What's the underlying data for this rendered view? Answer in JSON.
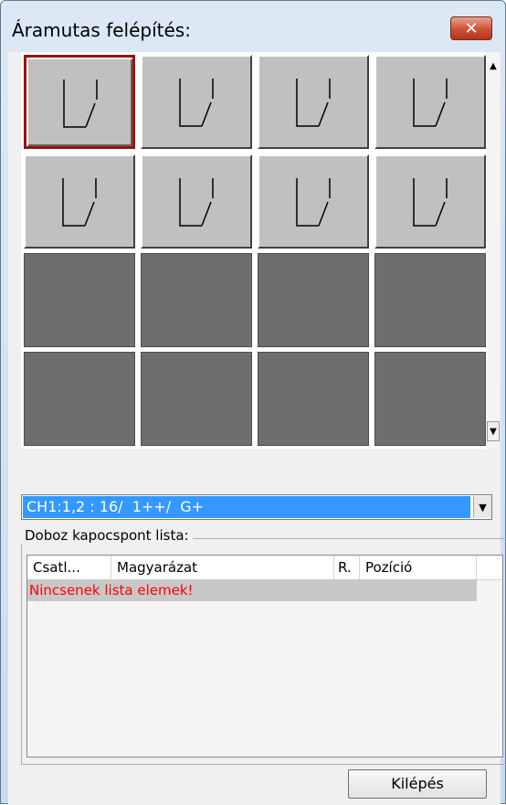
{
  "window": {
    "title": "Áramutas felépítés:",
    "close_label": "✕"
  },
  "tiles": [
    {
      "state": "selected",
      "symbol": "switch-icon"
    },
    {
      "state": "normal",
      "symbol": "switch-icon"
    },
    {
      "state": "normal",
      "symbol": "switch-icon"
    },
    {
      "state": "normal",
      "symbol": "switch-icon"
    },
    {
      "state": "normal",
      "symbol": "switch-icon"
    },
    {
      "state": "normal",
      "symbol": "switch-icon"
    },
    {
      "state": "normal",
      "symbol": "switch-icon"
    },
    {
      "state": "normal",
      "symbol": "switch-icon"
    },
    {
      "state": "empty"
    },
    {
      "state": "empty"
    },
    {
      "state": "empty"
    },
    {
      "state": "empty"
    },
    {
      "state": "empty"
    },
    {
      "state": "empty"
    },
    {
      "state": "empty"
    },
    {
      "state": "empty"
    }
  ],
  "scrollbar": {
    "up_icon": "▲",
    "down_icon": "▼"
  },
  "combo": {
    "value": "CH1:1,2 : 16/  1++/  G+",
    "arrow_icon": "▼"
  },
  "group": {
    "label": "Doboz kapocspont lista:"
  },
  "list": {
    "columns": [
      "Csatl...",
      "Magyarázat",
      "R.",
      "Pozíció"
    ],
    "empty_message": "Nincsenek lista elemek!"
  },
  "exit_button": "Kilépés"
}
